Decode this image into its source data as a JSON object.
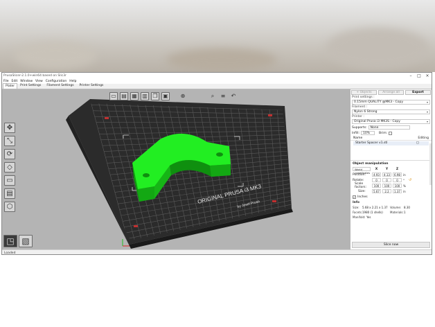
{
  "window": {
    "title": "PrusaSlicer-2.1.0+win64 based on Slic3r",
    "controls": [
      "–",
      "□",
      "×"
    ]
  },
  "menu": {
    "items": [
      "File",
      "Edit",
      "Window",
      "View",
      "Configuration",
      "Help"
    ]
  },
  "tabs": {
    "items": [
      "Plater",
      "Print Settings",
      "Filament Settings",
      "Printer Settings"
    ],
    "active_index": 0
  },
  "viewport": {
    "bed_label_line1": "ORIGINAL PRUSA i3 MK3",
    "bed_label_line2": "by Josef Prusa",
    "colors": {
      "background": "#b4b4b4",
      "bed": "#2b2b2b",
      "model": "#22ee22",
      "grid": "#5a5a5a"
    },
    "top_toolbar_icons": [
      "add-icon",
      "delete-icon",
      "delete-all-icon",
      "arrange-icon",
      "copy-icon",
      "paste-icon",
      "plus-icon",
      "search-icon",
      "layers-icon",
      "undo-icon"
    ],
    "left_toolbar_icons": [
      "move-icon",
      "scale-icon",
      "rotate-icon",
      "place-on-face-icon",
      "cut-icon",
      "support-paint-icon",
      "hollow-icon"
    ],
    "bottom_toolbar_icons": [
      "3d-view-icon",
      "preview-icon"
    ]
  },
  "sidebar": {
    "tab_add": "+ Objects",
    "tab_arrange": "Arrange all",
    "tab_export": "Export",
    "print_settings_label": "Print settings :",
    "print_settings_value": "0.15mm QUALITY @MK3 - Copy",
    "filament_label": "Filament :",
    "filament_value": "Nylon 6 Strong",
    "printer_label": "Printer :",
    "printer_value": "Original Prusa i3 MK3S - Copy",
    "supports_label": "Supports:",
    "supports_value": "None",
    "infill_label": "Infill:",
    "infill_value": "10%",
    "brim_label": "Brim:",
    "col_name": "Name",
    "col_editing": "Editing",
    "object_name": "Starter Spacer v1.stl",
    "object_manipulation_title": "Object manipulation",
    "coord_system": "World coordinates",
    "axis_x": "X",
    "axis_y": "Y",
    "axis_z": "Z",
    "position_label": "Position:",
    "position": [
      "4.93",
      "4.13",
      "6.98"
    ],
    "position_unit": "in",
    "rotate_label": "Rotate:",
    "rotate": [
      "0",
      "0",
      "0"
    ],
    "rotate_unit": "°",
    "scale_label": "Scale factors:",
    "scale": [
      "100",
      "100",
      "100"
    ],
    "scale_unit": "%",
    "size_label": "Size:",
    "size": [
      "5.67",
      "2.2",
      "1.37"
    ],
    "size_unit": "in",
    "inches_label": "Inches",
    "info_title": "Info",
    "info_size_key": "Size:",
    "info_size_val": "5.68 x 2.21 x 1.37",
    "info_volume_key": "Volume:",
    "info_volume_val": "8.30",
    "info_facets_key": "Facets:",
    "info_facets_val": "1980 (1 shells)",
    "info_materials_key": "Materials:",
    "info_materials_val": "1",
    "info_manifold_key": "Manifold:",
    "info_manifold_val": "Yes",
    "slice_button": "Slice now"
  },
  "status": {
    "text": "Loaded"
  }
}
